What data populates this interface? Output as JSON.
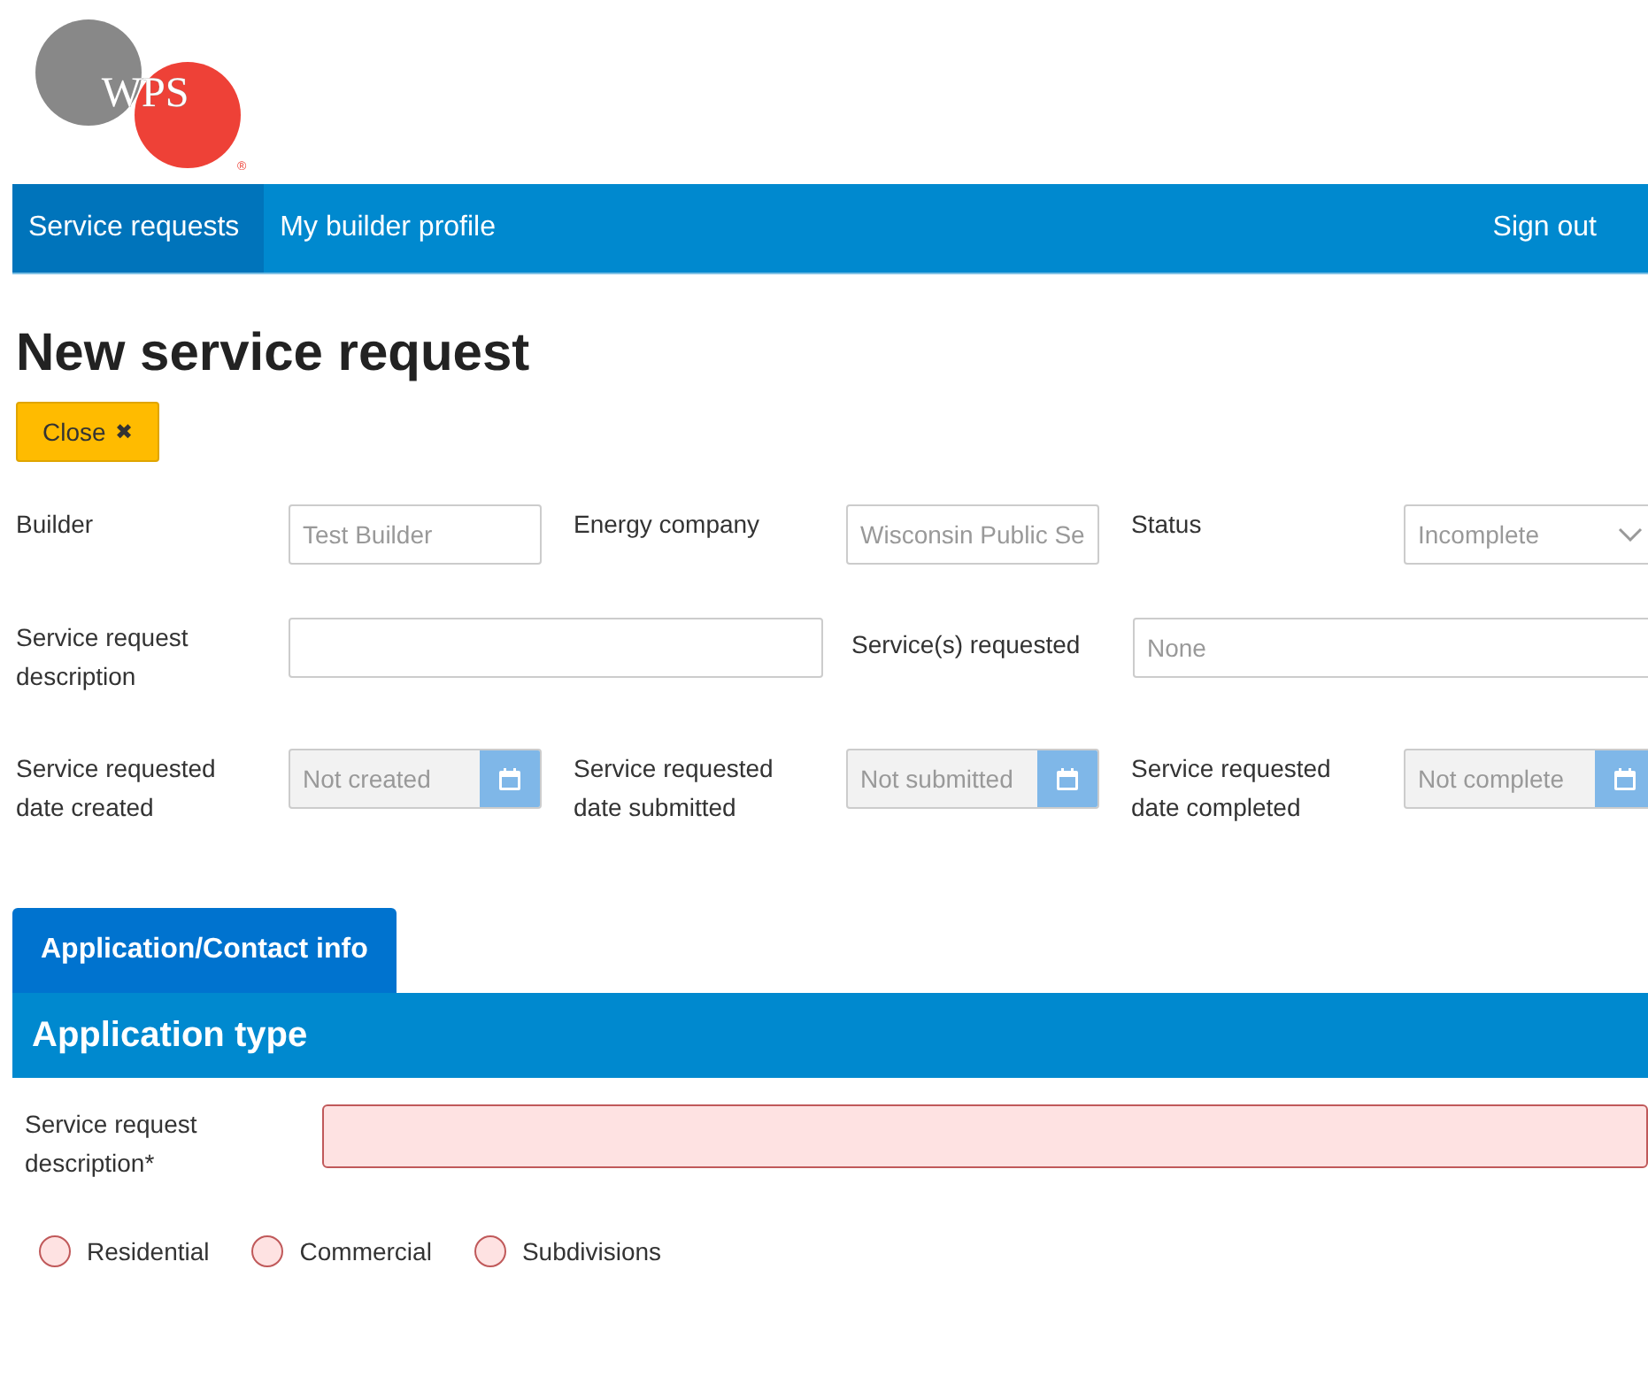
{
  "logo": {
    "text": "WPS",
    "mark": "®"
  },
  "nav": {
    "items": [
      {
        "label": "Service requests",
        "selected": true
      },
      {
        "label": "My builder profile",
        "selected": false
      }
    ],
    "sign_out": "Sign out"
  },
  "page_title": "New service request",
  "close_button": {
    "label": "Close",
    "icon": "✖"
  },
  "fields": [
    {
      "label": "Builder",
      "value": "Test Builder",
      "kind": "text"
    },
    {
      "label": "Energy company",
      "value": "Wisconsin Public Se",
      "kind": "text"
    },
    {
      "label": "Status",
      "value": "Incomplete",
      "kind": "select"
    },
    {
      "label": "Service request description",
      "kind": "wide"
    },
    {
      "label": "Service(s) requested",
      "placeholder": "None",
      "kind": "wide"
    },
    {
      "label": "Service requested date created",
      "placeholder": "Not created",
      "kind": "date"
    },
    {
      "label": "Service requested date submitted",
      "placeholder": "Not submitted",
      "kind": "date"
    },
    {
      "label": "Service requested date completed",
      "placeholder": "Not complete",
      "kind": "date"
    }
  ],
  "tabs": [
    {
      "label": "Application/Contact info",
      "selected": true
    }
  ],
  "section": {
    "title": "Application type",
    "required_field": {
      "label": "Service request description*",
      "invalid": true
    },
    "options": [
      {
        "label": "Residential",
        "selected": false
      },
      {
        "label": "Commercial",
        "selected": false
      },
      {
        "label": "Subdivisions",
        "selected": false
      }
    ]
  }
}
